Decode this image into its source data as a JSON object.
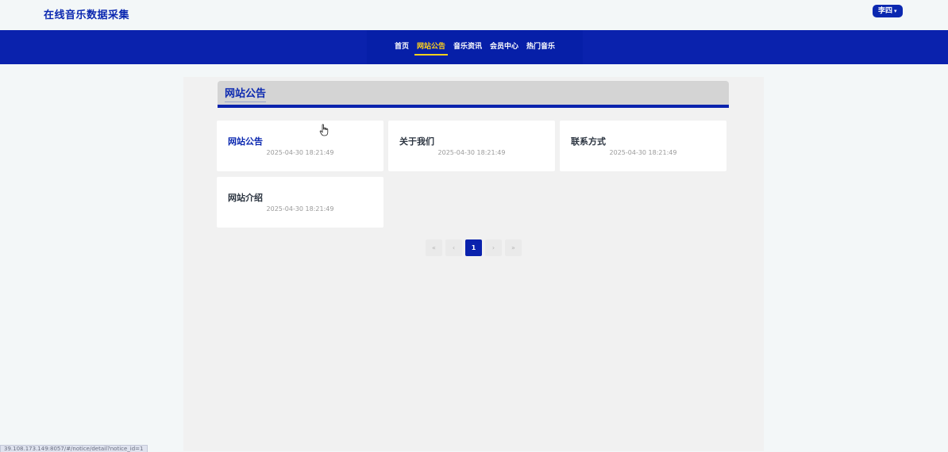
{
  "header": {
    "site_title": "在线音乐数据采集",
    "user_name": "李四",
    "user_caret": "▾"
  },
  "nav": {
    "items": [
      {
        "label": "首页"
      },
      {
        "label": "网站公告"
      },
      {
        "label": "音乐资讯"
      },
      {
        "label": "会员中心"
      },
      {
        "label": "热门音乐"
      }
    ],
    "active_index": 1
  },
  "section": {
    "title": "网站公告"
  },
  "notices": [
    {
      "title": "网站公告",
      "date": "2025-04-30 18:21:49"
    },
    {
      "title": "关于我们",
      "date": "2025-04-30 18:21:49"
    },
    {
      "title": "联系方式",
      "date": "2025-04-30 18:21:49"
    },
    {
      "title": "网站介绍",
      "date": "2025-04-30 18:21:49"
    }
  ],
  "pagination": {
    "first": "«",
    "prev": "‹",
    "current": "1",
    "next": "›",
    "last": "»"
  },
  "status_bar": {
    "url": "39.108.173.149:8057/#/notice/detail?notice_id=1"
  },
  "colors": {
    "brand": "#0b28b0",
    "nav_bg": "#0a22ad",
    "nav_active": "#ffd21c"
  }
}
